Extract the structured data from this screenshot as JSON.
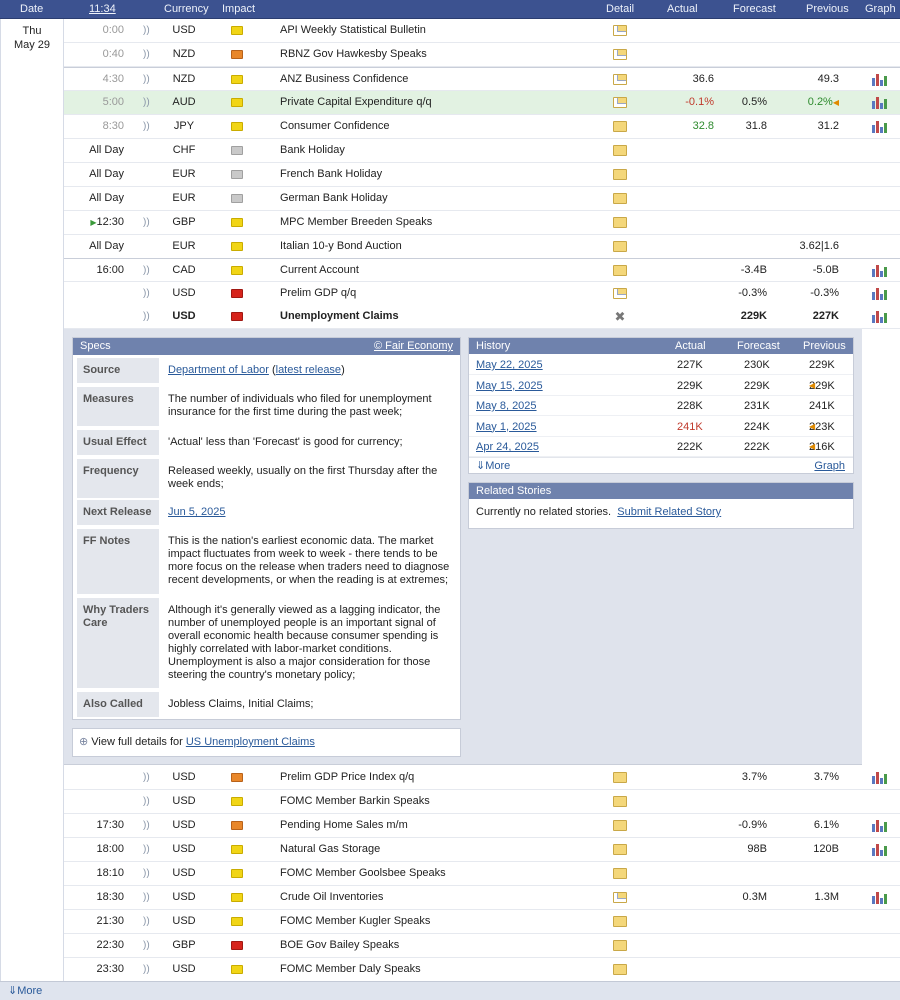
{
  "header": {
    "date": "Date",
    "time": "11:34",
    "currency": "Currency",
    "impact": "Impact",
    "detail": "Detail",
    "actual": "Actual",
    "forecast": "Forecast",
    "previous": "Previous",
    "graph": "Graph"
  },
  "day": {
    "weekday": "Thu",
    "date": "May 29"
  },
  "events": [
    {
      "time": "0:00",
      "currency": "USD",
      "impact": "yellow",
      "name": "API Weekly Statistical Bulletin",
      "detail": "folder-open",
      "actual": "",
      "forecast": "",
      "previous": "",
      "graph": false
    },
    {
      "time": "0:40",
      "currency": "NZD",
      "impact": "orange",
      "name": "RBNZ Gov Hawkesby Speaks",
      "detail": "folder-open",
      "actual": "",
      "forecast": "",
      "previous": "",
      "graph": false
    },
    {
      "time": "4:30",
      "currency": "NZD",
      "impact": "yellow",
      "name": "ANZ Business Confidence",
      "detail": "folder-open",
      "actual": "36.6",
      "forecast": "",
      "previous": "49.3",
      "graph": true
    },
    {
      "time": "5:00",
      "currency": "AUD",
      "impact": "yellow",
      "name": "Private Capital Expenditure q/q",
      "detail": "folder-open",
      "actual": "-0.1%",
      "forecast": "0.5%",
      "previous": "0.2%",
      "graph": true
    },
    {
      "time": "8:30",
      "currency": "JPY",
      "impact": "yellow",
      "name": "Consumer Confidence",
      "detail": "folder",
      "actual": "32.8",
      "forecast": "31.8",
      "previous": "31.2",
      "graph": true
    },
    {
      "time": "All Day",
      "currency": "CHF",
      "impact": "gray",
      "name": "Bank Holiday",
      "detail": "folder",
      "actual": "",
      "forecast": "",
      "previous": "",
      "graph": false
    },
    {
      "time": "All Day",
      "currency": "EUR",
      "impact": "gray",
      "name": "French Bank Holiday",
      "detail": "folder",
      "actual": "",
      "forecast": "",
      "previous": "",
      "graph": false
    },
    {
      "time": "All Day",
      "currency": "EUR",
      "impact": "gray",
      "name": "German Bank Holiday",
      "detail": "folder",
      "actual": "",
      "forecast": "",
      "previous": "",
      "graph": false
    },
    {
      "time": "12:30",
      "currency": "GBP",
      "impact": "yellow",
      "name": "MPC Member Breeden Speaks",
      "detail": "folder",
      "actual": "",
      "forecast": "",
      "previous": "",
      "graph": false
    },
    {
      "time": "All Day",
      "currency": "EUR",
      "impact": "yellow",
      "name": "Italian 10-y Bond Auction",
      "detail": "folder",
      "actual": "",
      "forecast": "",
      "previous": "3.62|1.6",
      "graph": false
    },
    {
      "time": "16:00",
      "currency": "CAD",
      "impact": "yellow",
      "name": "Current Account",
      "detail": "folder",
      "actual": "",
      "forecast": "-3.4B",
      "previous": "-5.0B",
      "graph": true
    },
    {
      "time": "",
      "currency": "USD",
      "impact": "red",
      "name": "Prelim GDP q/q",
      "detail": "folder-open",
      "actual": "",
      "forecast": "-0.3%",
      "previous": "-0.3%",
      "graph": true
    },
    {
      "time": "",
      "currency": "USD",
      "impact": "red",
      "name": "Unemployment Claims",
      "detail": "close",
      "actual": "",
      "forecast": "229K",
      "previous": "227K",
      "graph": true
    },
    {
      "time": "",
      "currency": "USD",
      "impact": "orange",
      "name": "Prelim GDP Price Index q/q",
      "detail": "folder",
      "actual": "",
      "forecast": "3.7%",
      "previous": "3.7%",
      "graph": true
    },
    {
      "time": "",
      "currency": "USD",
      "impact": "yellow",
      "name": "FOMC Member Barkin Speaks",
      "detail": "folder",
      "actual": "",
      "forecast": "",
      "previous": "",
      "graph": false
    },
    {
      "time": "17:30",
      "currency": "USD",
      "impact": "orange",
      "name": "Pending Home Sales m/m",
      "detail": "folder",
      "actual": "",
      "forecast": "-0.9%",
      "previous": "6.1%",
      "graph": true
    },
    {
      "time": "18:00",
      "currency": "USD",
      "impact": "yellow",
      "name": "Natural Gas Storage",
      "detail": "folder",
      "actual": "",
      "forecast": "98B",
      "previous": "120B",
      "graph": true
    },
    {
      "time": "18:10",
      "currency": "USD",
      "impact": "yellow",
      "name": "FOMC Member Goolsbee Speaks",
      "detail": "folder",
      "actual": "",
      "forecast": "",
      "previous": "",
      "graph": false
    },
    {
      "time": "18:30",
      "currency": "USD",
      "impact": "yellow",
      "name": "Crude Oil Inventories",
      "detail": "folder-open",
      "actual": "",
      "forecast": "0.3M",
      "previous": "1.3M",
      "graph": true
    },
    {
      "time": "21:30",
      "currency": "USD",
      "impact": "yellow",
      "name": "FOMC Member Kugler Speaks",
      "detail": "folder",
      "actual": "",
      "forecast": "",
      "previous": "",
      "graph": false
    },
    {
      "time": "22:30",
      "currency": "GBP",
      "impact": "red",
      "name": "BOE Gov Bailey Speaks",
      "detail": "folder",
      "actual": "",
      "forecast": "",
      "previous": "",
      "graph": false
    },
    {
      "time": "23:30",
      "currency": "USD",
      "impact": "yellow",
      "name": "FOMC Member Daly Speaks",
      "detail": "folder",
      "actual": "",
      "forecast": "",
      "previous": "",
      "graph": false
    }
  ],
  "specs": {
    "title": "Specs",
    "source_link": "© Fair Economy",
    "rows": [
      {
        "label": "Source",
        "value": "Department of Labor",
        "value2": "latest release"
      },
      {
        "label": "Measures",
        "value": "The number of individuals who filed for unemployment insurance for the first time during the past week;"
      },
      {
        "label": "Usual Effect",
        "value": "'Actual' less than 'Forecast' is good for currency;"
      },
      {
        "label": "Frequency",
        "value": "Released weekly, usually on the first Thursday after the week ends;"
      },
      {
        "label": "Next Release",
        "value": "Jun 5, 2025"
      },
      {
        "label": "FF Notes",
        "value": "This is the nation's earliest economic data. The market impact fluctuates from week to week - there tends to be more focus on the release when traders need to diagnose recent developments, or when the reading is at extremes;"
      },
      {
        "label": "Why Traders Care",
        "value": "Although it's generally viewed as a lagging indicator, the number of unemployed people is an important signal of overall economic health because consumer spending is highly correlated with labor-market conditions. Unemployment is also a major consideration for those steering the country's monetary policy;"
      },
      {
        "label": "Also Called",
        "value": "Jobless Claims, Initial Claims;"
      }
    ],
    "view_full_prefix": "View full details for",
    "view_full_link": "US Unemployment Claims"
  },
  "history": {
    "title": "History",
    "col_actual": "Actual",
    "col_forecast": "Forecast",
    "col_previous": "Previous",
    "rows": [
      {
        "date": "May 22, 2025",
        "actual": "227K",
        "forecast": "230K",
        "previous": "229K"
      },
      {
        "date": "May 15, 2025",
        "actual": "229K",
        "forecast": "229K",
        "previous": "229K"
      },
      {
        "date": "May 8, 2025",
        "actual": "228K",
        "forecast": "231K",
        "previous": "241K"
      },
      {
        "date": "May 1, 2025",
        "actual": "241K",
        "forecast": "224K",
        "previous": "223K"
      },
      {
        "date": "Apr 24, 2025",
        "actual": "222K",
        "forecast": "222K",
        "previous": "216K"
      }
    ],
    "more": "More",
    "graph": "Graph"
  },
  "related": {
    "title": "Related Stories",
    "text": "Currently no related stories.",
    "link": "Submit Related Story"
  },
  "footer": {
    "more": "More"
  }
}
